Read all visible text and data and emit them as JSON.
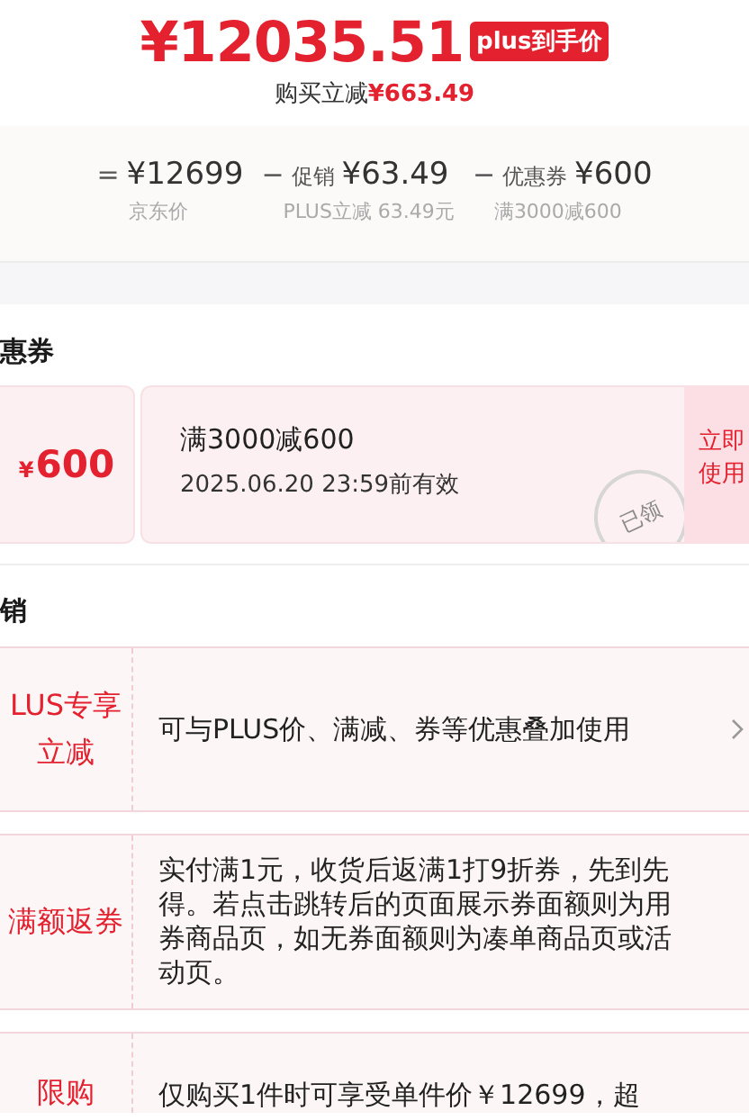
{
  "price": {
    "amount": "¥12035.51",
    "badge": "plus到手价",
    "saving_label": "购买立减",
    "saving_amount": "¥663.49"
  },
  "breakdown": [
    {
      "operator": "=",
      "value": "¥12699",
      "note": "京东价"
    },
    {
      "operator": "−",
      "label": "促销",
      "value": "¥63.49",
      "note": "PLUS立减 63.49元"
    },
    {
      "operator": "−",
      "label": "优惠券",
      "value": "¥600",
      "note": "满3000减600"
    }
  ],
  "coupon_section": {
    "title": "惠券",
    "coupon": {
      "currency": "¥",
      "amount": "600",
      "condition": "满3000减600",
      "validity": "2025.06.20 23:59前有效",
      "stamp": "已领",
      "action": [
        "立即",
        "使用"
      ]
    }
  },
  "promo_section": {
    "title": "销",
    "items": [
      {
        "label": [
          "LUS专享",
          "立减"
        ],
        "description": "可与PLUS价、满减、券等优惠叠加使用",
        "arrow": true
      },
      {
        "label": [
          "满额返券"
        ],
        "description": "实付满1元，收货后返满1打9折券，先到先得。若点击跳转后的页面展示券面额则为用券商品页，如无券面额则为凑单商品页或活动页。",
        "arrow": false
      },
      {
        "label": [
          "限购"
        ],
        "description": "仅购买1件时可享受单件价￥12699，超",
        "arrow": false
      }
    ]
  }
}
